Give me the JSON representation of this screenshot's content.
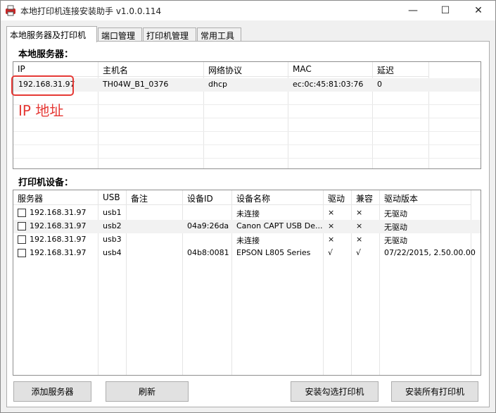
{
  "window": {
    "title": "本地打印机连接安装助手 v1.0.0.114",
    "minimize_glyph": "—",
    "maximize_glyph": "☐",
    "close_glyph": "✕"
  },
  "tabs": [
    {
      "label": "本地服务器及打印机",
      "active": true
    },
    {
      "label": "端口管理",
      "active": false
    },
    {
      "label": "打印机管理",
      "active": false
    },
    {
      "label": "常用工具",
      "active": false
    }
  ],
  "servers_section": {
    "title": "本地服务器：",
    "columns": [
      "IP",
      "主机名",
      "网络协议",
      "MAC",
      "延迟"
    ],
    "rows": [
      {
        "ip": "192.168.31.97",
        "hostname": "TH04W_B1_0376",
        "protocol": "dhcp",
        "mac": "ec:0c:45:81:03:76",
        "latency": "0"
      }
    ]
  },
  "annotation": {
    "label": "IP 地址",
    "color": "#e53935"
  },
  "printers_section": {
    "title": "打印机设备：",
    "columns": [
      "服务器",
      "USB",
      "备注",
      "设备ID",
      "设备名称",
      "驱动",
      "兼容",
      "驱动版本"
    ],
    "rows": [
      {
        "server": "192.168.31.97",
        "usb": "usb1",
        "note": "",
        "device_id": "",
        "device_name": "未连接",
        "driver": "×",
        "compat": "×",
        "driver_version": "无驱动"
      },
      {
        "server": "192.168.31.97",
        "usb": "usb2",
        "note": "",
        "device_id": "04a9:26da",
        "device_name": "Canon CAPT USB De...",
        "driver": "×",
        "compat": "×",
        "driver_version": "无驱动"
      },
      {
        "server": "192.168.31.97",
        "usb": "usb3",
        "note": "",
        "device_id": "",
        "device_name": "未连接",
        "driver": "×",
        "compat": "×",
        "driver_version": "无驱动"
      },
      {
        "server": "192.168.31.97",
        "usb": "usb4",
        "note": "",
        "device_id": "04b8:0081",
        "device_name": "EPSON L805 Series",
        "driver": "√",
        "compat": "√",
        "driver_version": "07/22/2015, 2.50.00.00"
      }
    ]
  },
  "buttons": {
    "add_server": "添加服务器",
    "refresh": "刷新",
    "install_selected": "安装勾选打印机",
    "install_all": "安装所有打印机"
  }
}
